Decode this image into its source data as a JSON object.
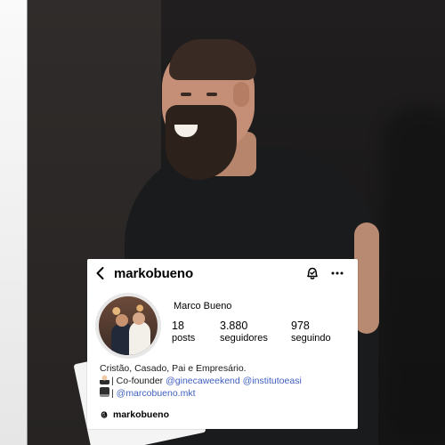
{
  "profile": {
    "username": "markobueno",
    "full_name": "Marco Bueno",
    "stats": [
      {
        "value": "18",
        "label": "posts"
      },
      {
        "value": "3.880",
        "label": "seguidores"
      },
      {
        "value": "978",
        "label": "seguindo"
      }
    ],
    "bio": {
      "line1": "Cristão, Casado, Pai e Empresário.",
      "line2_prefix": "| Co-founder",
      "mention1": "@ginecaweekend",
      "mention2": "@institutoeasi",
      "line3_prefix": "| ",
      "mention3": "@marcobueno.mkt"
    },
    "threads_handle": "markobueno"
  },
  "icons": {
    "back": "chevron-left-icon",
    "notifications": "bell-check-icon",
    "more": "more-horizontal-icon",
    "threads": "threads-icon"
  },
  "colors": {
    "mention": "#3f5fbf",
    "card_bg": "#ffffff",
    "text": "#000000"
  }
}
